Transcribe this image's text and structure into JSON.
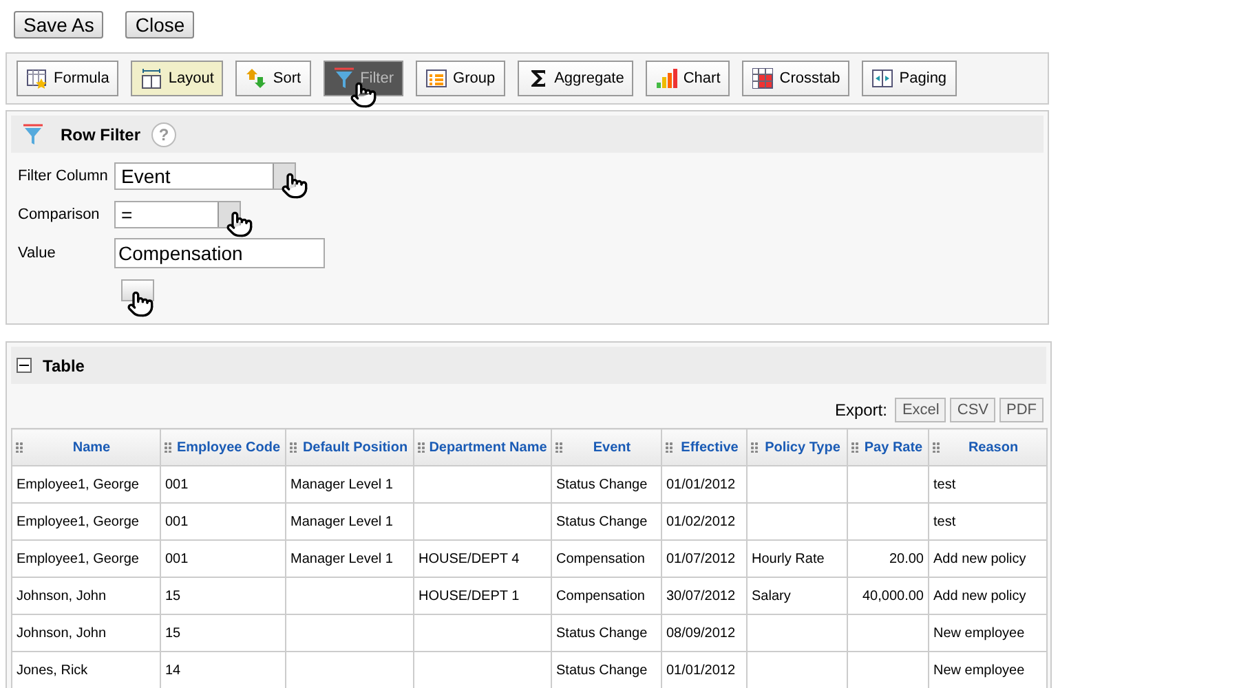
{
  "top_buttons": [
    "Save As",
    "Close"
  ],
  "toolbar": [
    {
      "label": "Formula",
      "selected": false,
      "highlighted": false
    },
    {
      "label": "Layout",
      "selected": false,
      "highlighted": true
    },
    {
      "label": "Sort",
      "selected": false,
      "highlighted": false
    },
    {
      "label": "Filter",
      "selected": true,
      "highlighted": false
    },
    {
      "label": "Group",
      "selected": false,
      "highlighted": false
    },
    {
      "label": "Aggregate",
      "selected": false,
      "highlighted": false
    },
    {
      "label": "Chart",
      "selected": false,
      "highlighted": false
    },
    {
      "label": "Crosstab",
      "selected": false,
      "highlighted": false
    },
    {
      "label": "Paging",
      "selected": false,
      "highlighted": false
    }
  ],
  "row_filter": {
    "title": "Row Filter",
    "help": "?",
    "fields": [
      {
        "label": "Filter Column",
        "kind": "select",
        "value": "Event"
      },
      {
        "label": "Comparison",
        "kind": "select",
        "value": "="
      },
      {
        "label": "Value",
        "kind": "text",
        "value": "Compensation"
      }
    ]
  },
  "table_panel": {
    "title": "Table",
    "expanded": true,
    "export_label": "Export:",
    "export_buttons": [
      "Excel",
      "CSV",
      "PDF"
    ],
    "columns": [
      "Name",
      "Employee Code",
      "Default Position",
      "Department Name",
      "Event",
      "Effective",
      "Policy Type",
      "Pay Rate",
      "Reason"
    ],
    "rows": [
      [
        "Employee1, George",
        "001",
        "Manager Level 1",
        "",
        "Status Change",
        "01/01/2012",
        "",
        "",
        "test"
      ],
      [
        "Employee1, George",
        "001",
        "Manager Level 1",
        "",
        "Status Change",
        "01/02/2012",
        "",
        "",
        "test"
      ],
      [
        "Employee1, George",
        "001",
        "Manager Level 1",
        "HOUSE/DEPT 4",
        "Compensation",
        "01/07/2012",
        "Hourly Rate",
        "20.00",
        "Add new policy"
      ],
      [
        "Johnson, John",
        "15",
        "",
        "HOUSE/DEPT 1",
        "Compensation",
        "30/07/2012",
        "Salary",
        "40,000.00",
        "Add new policy"
      ],
      [
        "Johnson, John",
        "15",
        "",
        "",
        "Status Change",
        "08/09/2012",
        "",
        "",
        "New employee"
      ],
      [
        "Jones, Rick",
        "14",
        "",
        "",
        "Status Change",
        "01/01/2012",
        "",
        "",
        "New employee"
      ]
    ]
  }
}
